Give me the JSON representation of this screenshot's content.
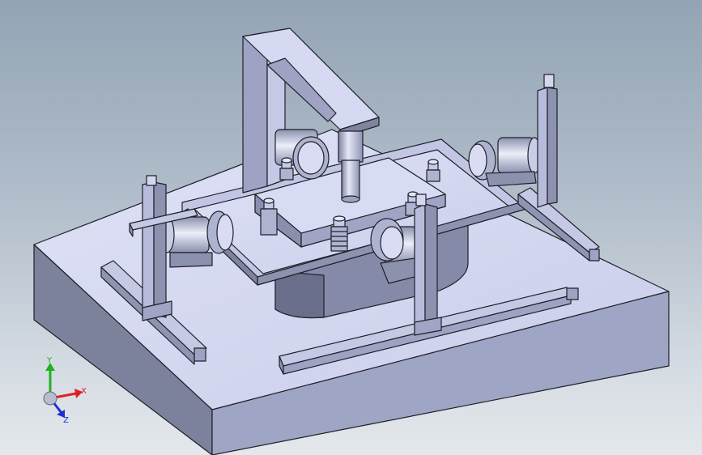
{
  "viewport": {
    "background_top": "#93a4b4",
    "background_bottom": "#e4e8ec",
    "model_face_light": "#d6daf2",
    "model_face_mid": "#a6acca",
    "model_face_dark": "#5a5f78",
    "edge_color": "#202028"
  },
  "triad": {
    "x_label": "X",
    "y_label": "Y",
    "z_label": "Z",
    "x_color": "#e02020",
    "y_color": "#20b020",
    "z_color": "#2030d0"
  }
}
